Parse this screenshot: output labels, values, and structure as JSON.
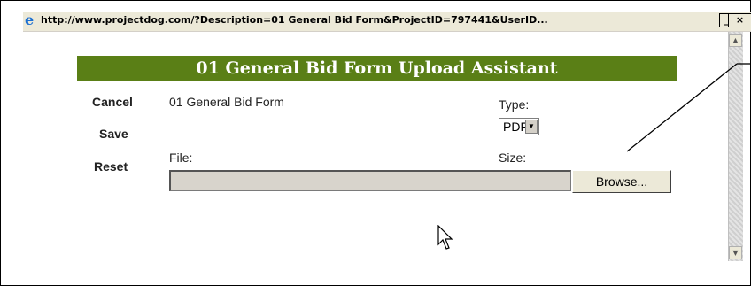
{
  "window": {
    "title": "http://www.projectdog.com/?Description=01 General Bid Form&ProjectID=797441&UserID...",
    "icon": "ie-icon",
    "minimize": "_",
    "maximize": "□",
    "close": "×"
  },
  "dialog": {
    "header": "01 General Bid Form Upload Assistant",
    "header_color": "#5a7f16",
    "actions": {
      "cancel": "Cancel",
      "save": "Save",
      "reset": "Reset"
    },
    "description": "01 General Bid Form",
    "type_label": "Type:",
    "type_value": "PDF",
    "file_label": "File:",
    "size_label": "Size:",
    "browse_label": "Browse...",
    "file_value": ""
  },
  "scrollbar": {
    "up": "▲",
    "down": "▼"
  }
}
